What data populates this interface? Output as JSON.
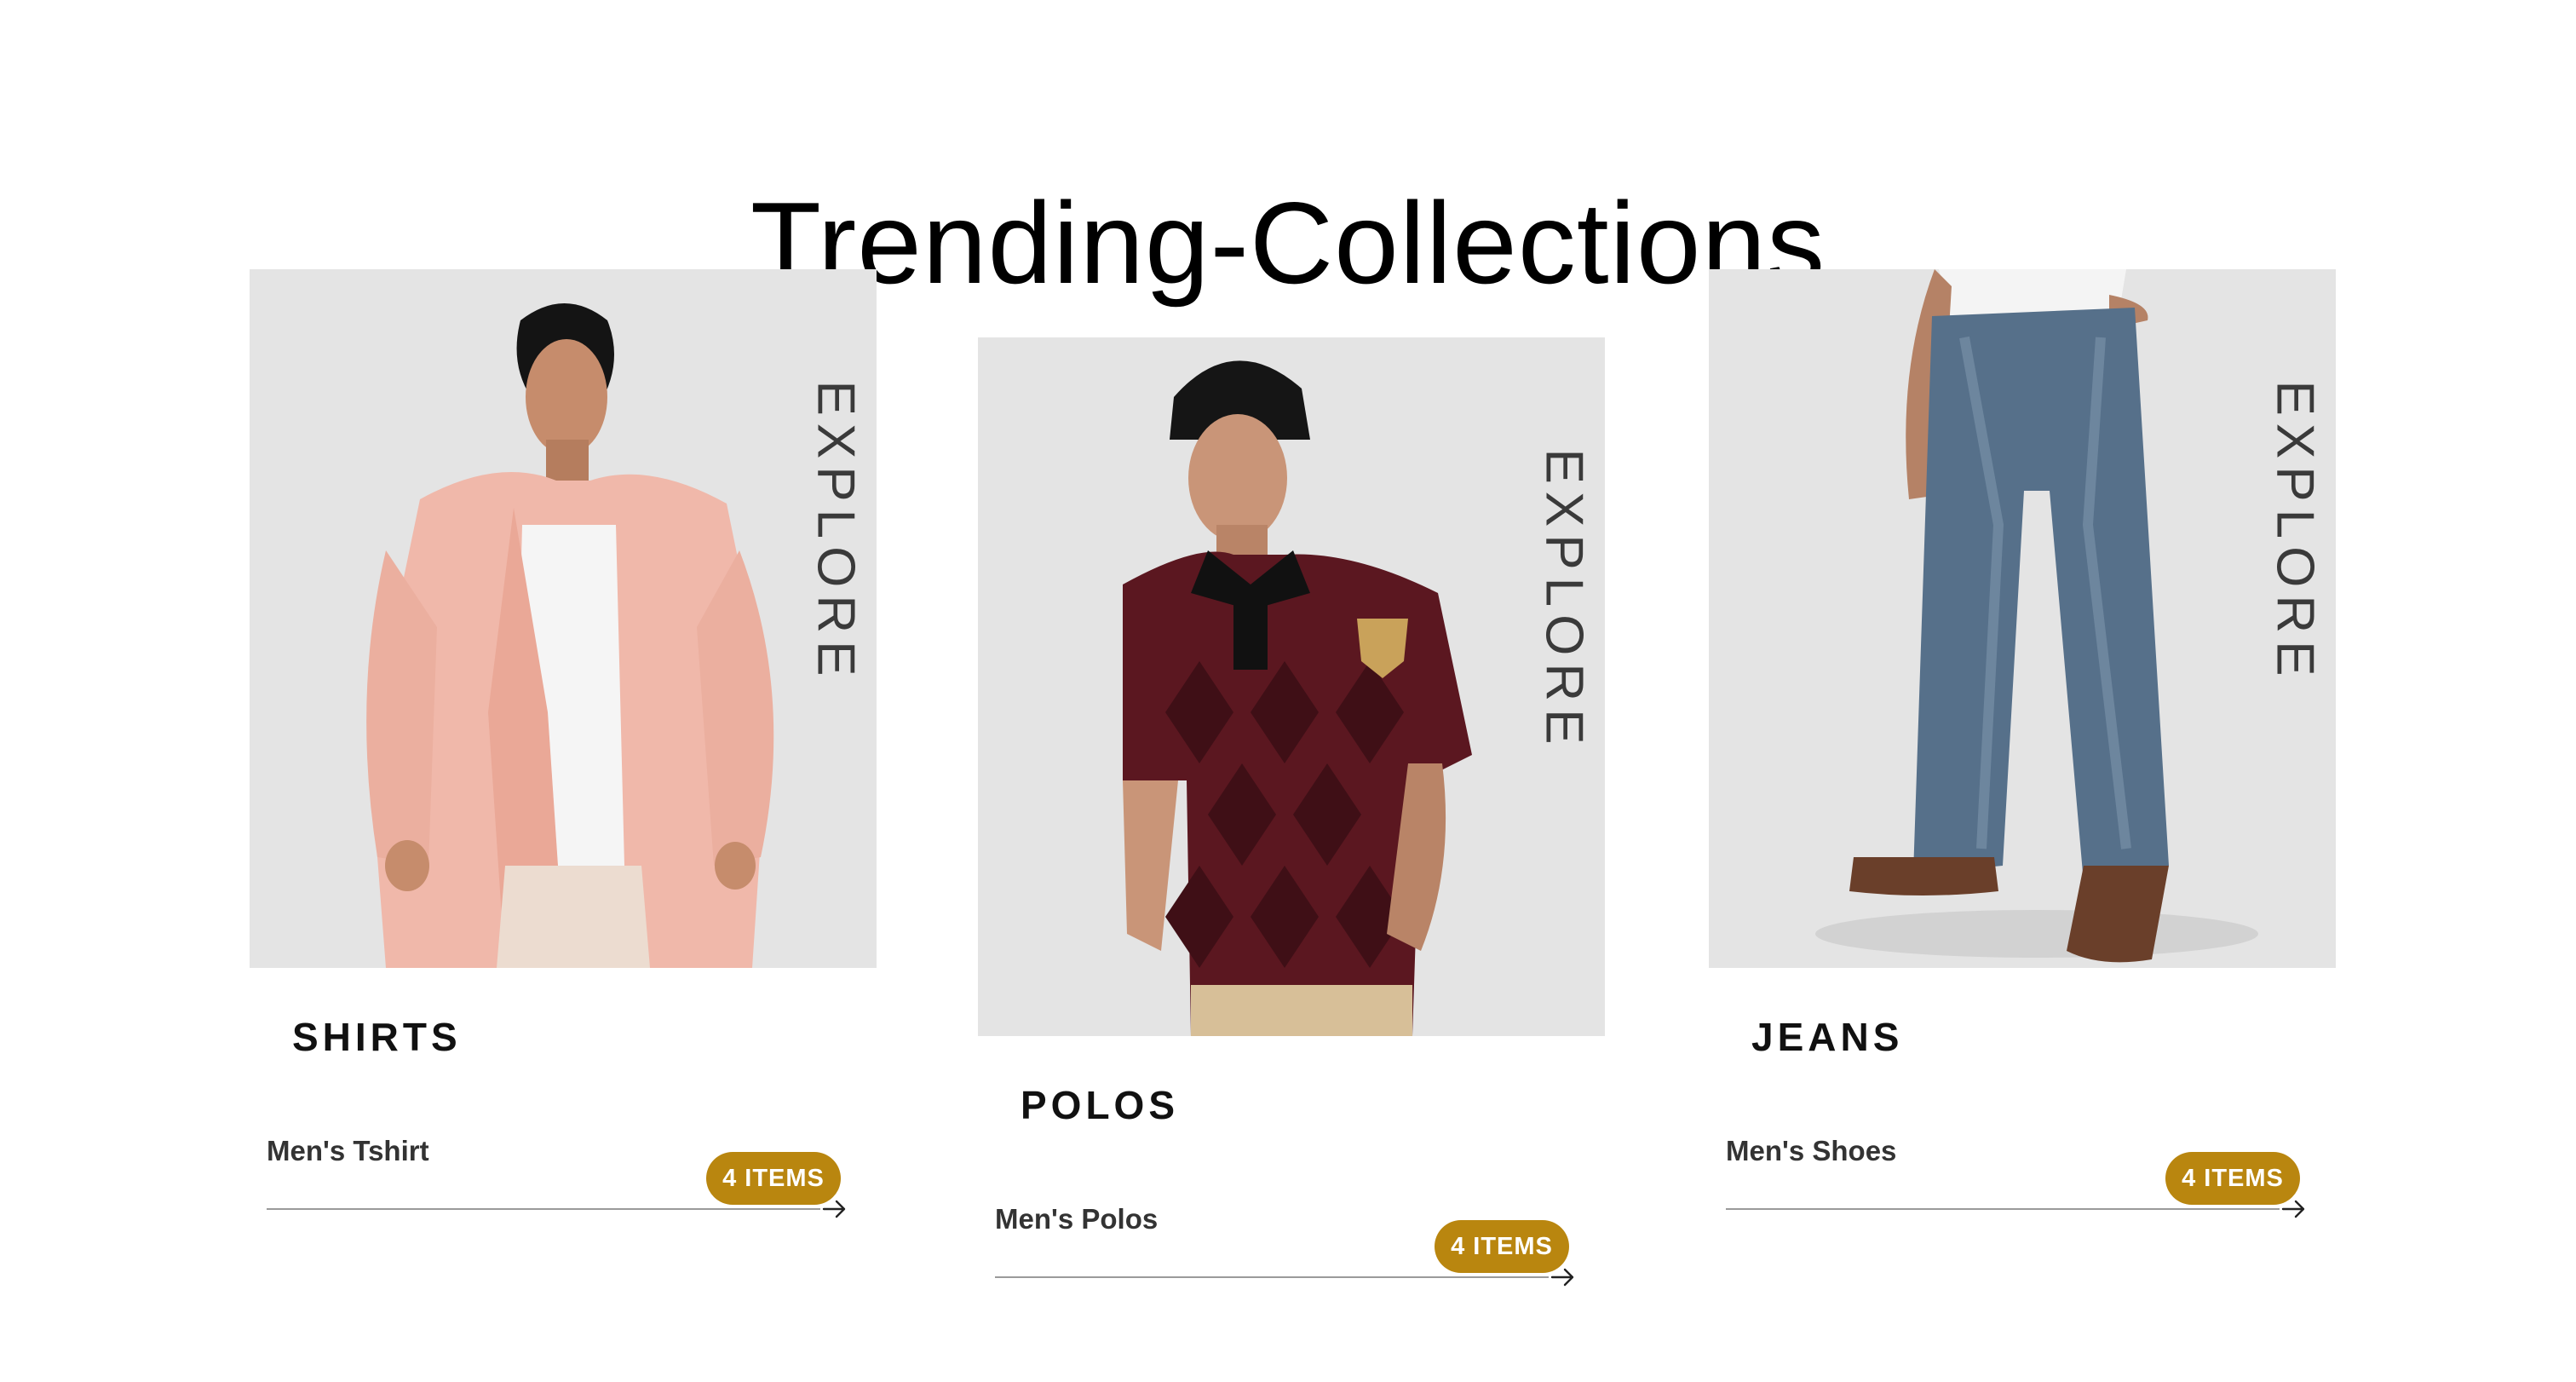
{
  "page": {
    "title": "Trending-Collections"
  },
  "colors": {
    "badge": "#b9860f",
    "panel": "#e4e4e4"
  },
  "cards": [
    {
      "explore": "EXPLORE",
      "name": "SHIRTS",
      "link": "Men's Tshirt",
      "badge": "4 ITEMS",
      "icon": "arrow-right-icon"
    },
    {
      "explore": "EXPLORE",
      "name": "POLOS",
      "link": "Men's Polos",
      "badge": "4 ITEMS",
      "icon": "arrow-right-icon"
    },
    {
      "explore": "EXPLORE",
      "name": "JEANS",
      "link": "Men's Shoes",
      "badge": "4 ITEMS",
      "icon": "arrow-right-icon"
    }
  ]
}
